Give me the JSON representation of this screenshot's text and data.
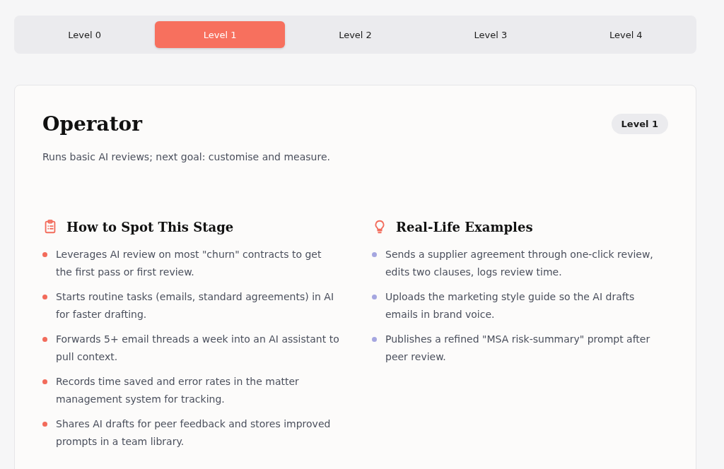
{
  "tabs": [
    {
      "label": "Level 0",
      "selected": false
    },
    {
      "label": "Level 1",
      "selected": true
    },
    {
      "label": "Level 2",
      "selected": false
    },
    {
      "label": "Level 3",
      "selected": false
    },
    {
      "label": "Level 4",
      "selected": false
    }
  ],
  "card": {
    "title": "Operator",
    "badge": "Level 1",
    "description": "Runs basic AI reviews; next goal: customise and measure.",
    "sections": [
      {
        "kind": "checklist",
        "heading": "How to Spot This Stage",
        "color": "#f26b5b",
        "items": [
          "Leverages AI review on most \"churn\" contracts to get the first pass or first review.",
          "Starts routine tasks (emails, standard agreements) in AI for faster drafting.",
          "Forwards 5+ email threads a week into an AI assistant to pull context.",
          "Records time saved and error rates in the matter management system for tracking.",
          "Shares AI drafts for peer feedback and stores improved prompts in a team library."
        ]
      },
      {
        "kind": "idea",
        "heading": "Real-Life Examples",
        "color": "#a5a6e0",
        "items": [
          "Sends a supplier agreement through one-click review, edits two clauses, logs review time.",
          "Uploads the marketing style guide so the AI drafts emails in brand voice.",
          "Publishes a refined \"MSA risk-summary\" prompt after peer review."
        ]
      }
    ]
  }
}
